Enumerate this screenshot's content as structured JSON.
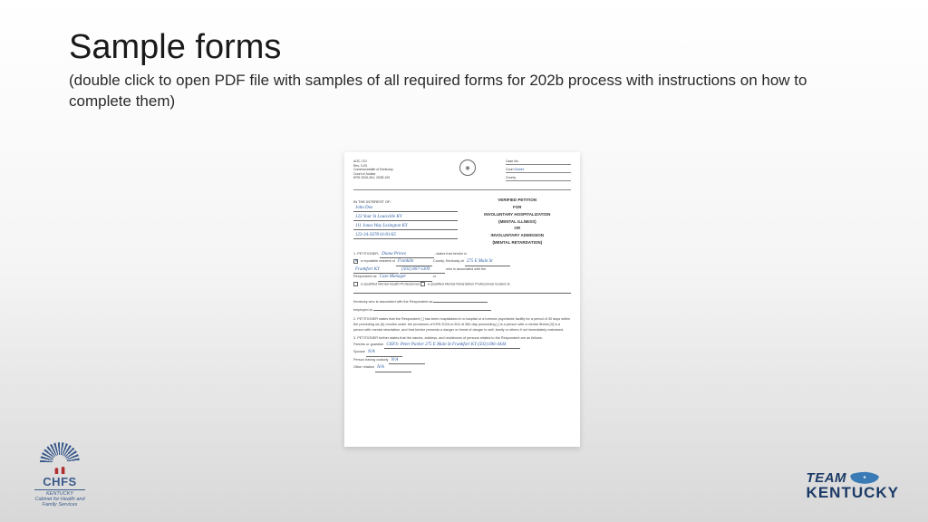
{
  "header": {
    "title": "Sample forms",
    "subtitle": "(double click to open PDF file with samples of all required forms for 202b process with instructions on how to complete them)"
  },
  "form": {
    "doc_code": "AOC-710",
    "rev": "Rev. 3-03",
    "commonwealth": "Commonwealth of Kentucky",
    "court": "Court of Justice",
    "krs": "KRS 202A.261; 202B.100",
    "case_no_label": "Case No.",
    "court_label": "Court",
    "county_label": "County",
    "court_value": "District",
    "interest_label": "IN THE INTEREST OF:",
    "respondent_name": "John Doe",
    "respondent_addr1": "123 Your St Louisville KY",
    "respondent_addr2": "111 Jones Way Lexington KY",
    "respondent_ssn_dob": "123-34-5678   01/01/65",
    "center_title_l1": "VERIFIED PETITION",
    "center_title_l2": "FOR",
    "center_title_l3": "INVOLUNTARY HOSPITALIZATION",
    "center_title_l4": "(MENTAL ILLNESS)",
    "center_title_l5": "OR",
    "center_title_l6": "INVOLUNTARY ADMISSION",
    "center_title_l7": "(MENTAL RETARDATION)",
    "petitioner_label": "1. PETITIONER,",
    "petitioner_name": "Diana Prince",
    "petitioner_county": "Franklin",
    "petitioner_addr": "275 E Main St",
    "petitioner_city": "Frankfort KY",
    "petitioner_phone": "(502) 867-5309",
    "relationship": "Case Manager",
    "section2_text": "2. PETITIONER states that the Respondent [ ] has been hospitalized in a hospital or a forensic psychiatric facility for a period of 30 days within the preceding six (6) months under the provisions of KRS 202A or 604 of 360-day proceeding [ ] is a person with a mental illness [X] is a person with mental retardation, and that he/she presents a danger or threat of danger to self, family or others if not immediately restrained.",
    "section3_text": "3. PETITIONER further states that the names, address, and residences of persons related to the Respondent are as follows:",
    "parents_label": "Parents or guardian",
    "parents_value": "CHFS- Peter Parker 275 E Main St Frankfort KY (502) 696-4444",
    "spouse_label": "Spouse",
    "spouse_value": "N/A",
    "custody_label": "Person having custody",
    "custody_value": "N/A",
    "other_label": "Other relation",
    "other_value": "N/A"
  },
  "logos": {
    "chfs_main": "CHFS",
    "chfs_line1": "KENTUCKY",
    "chfs_line2": "Cabinet for Health and",
    "chfs_line3": "Family Services",
    "team": "TEAM",
    "kentucky": "KENTUCKY"
  }
}
